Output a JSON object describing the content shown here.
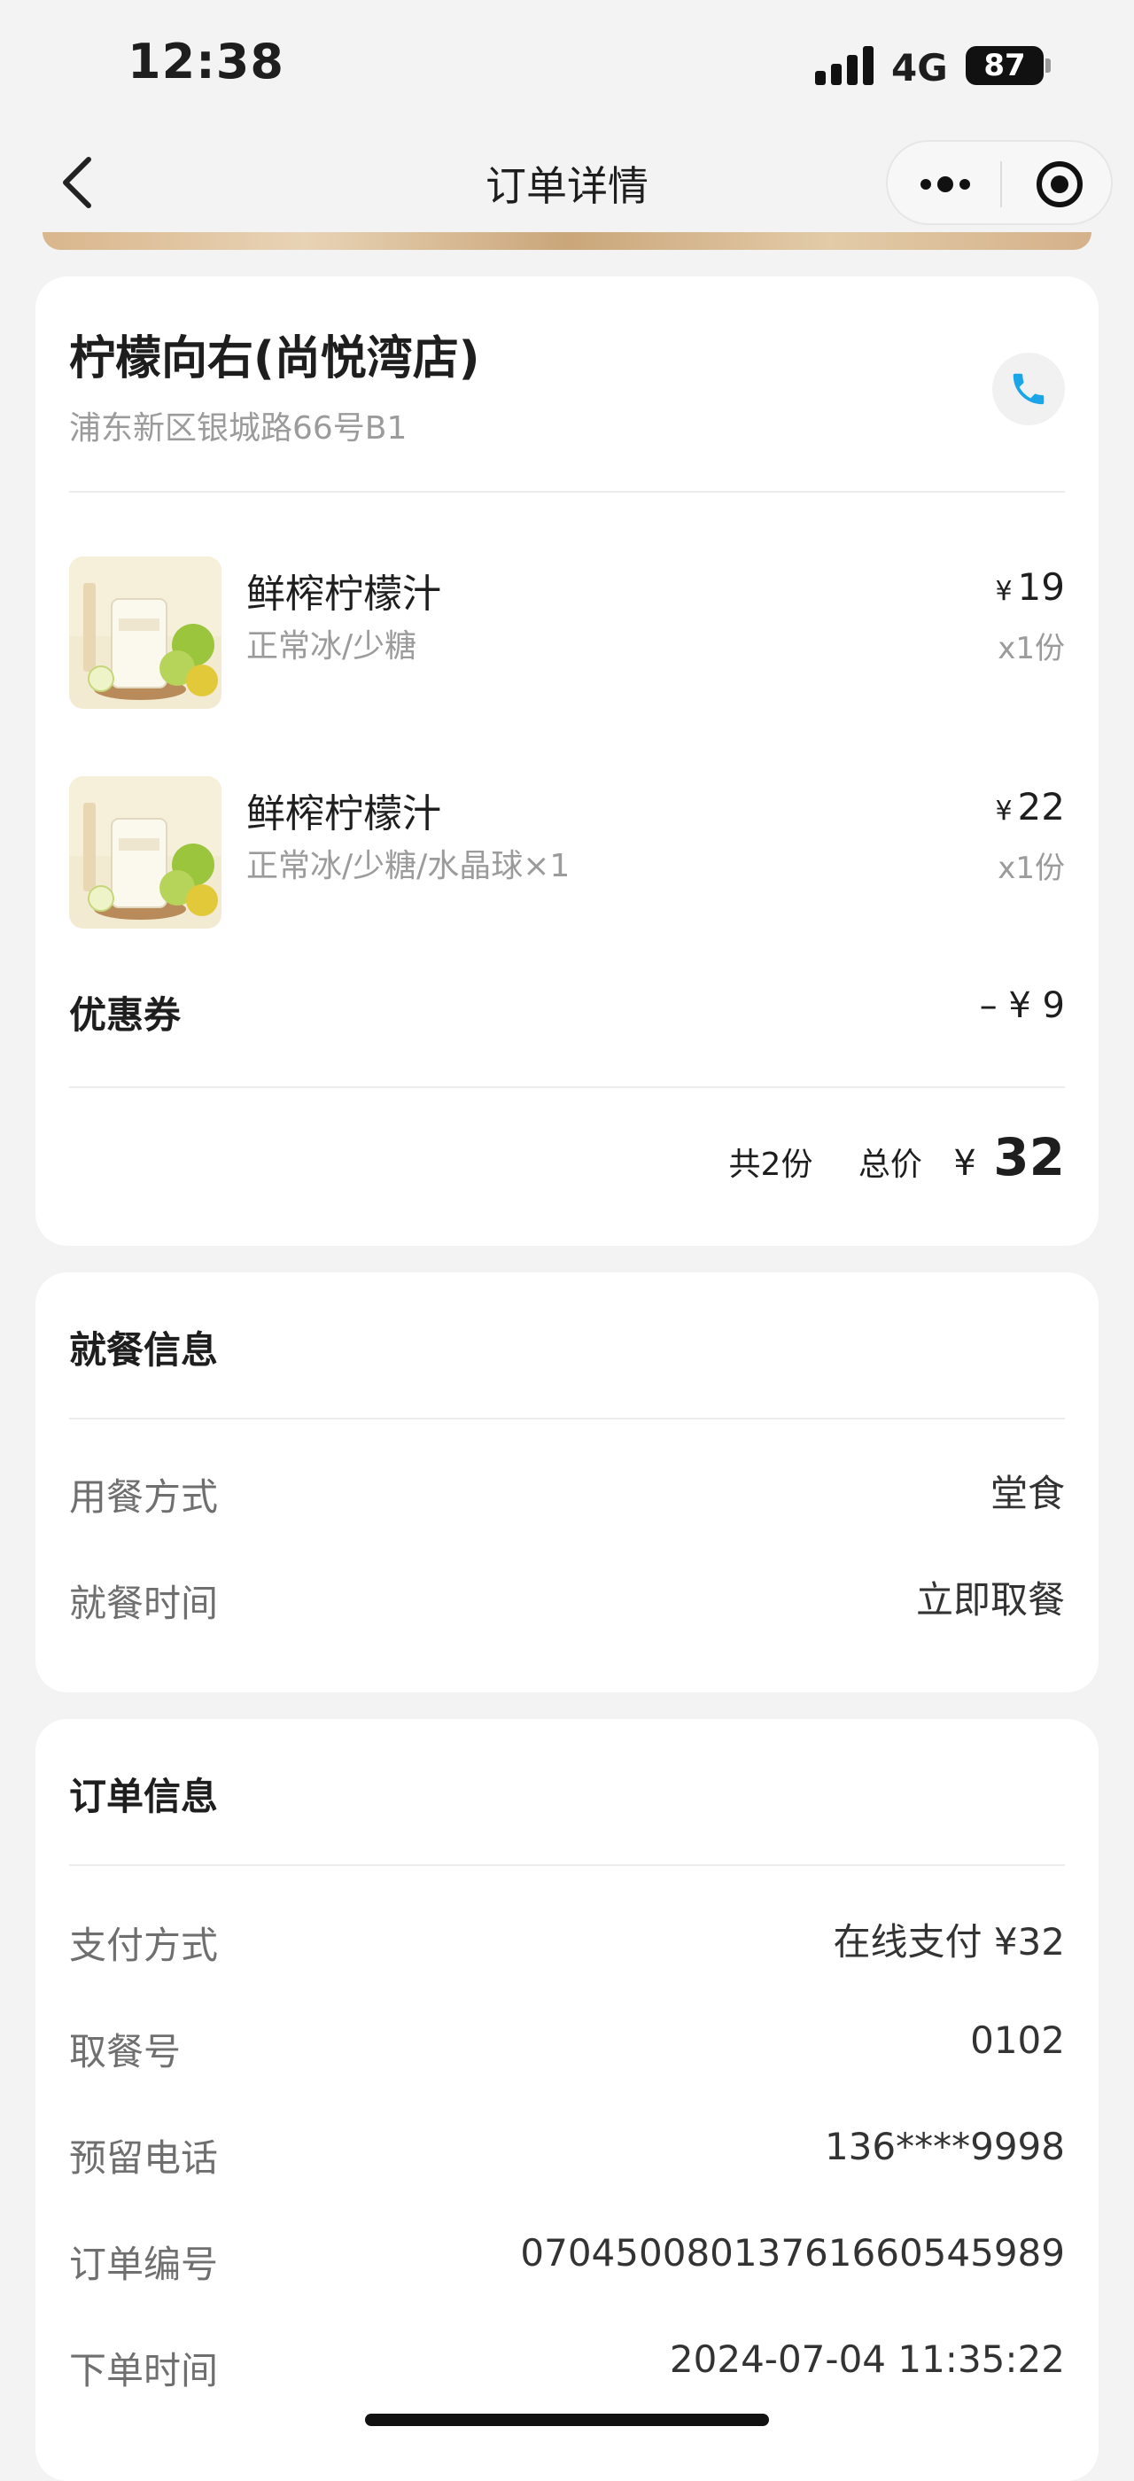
{
  "status_bar": {
    "time": "12:38",
    "network": "4G",
    "battery": "87"
  },
  "nav": {
    "title": "订单详情",
    "back_icon": "chevron-left-icon",
    "more_icon": "more-dots-icon",
    "close_icon": "target-icon"
  },
  "store": {
    "name": "柠檬向右(尚悦湾店)",
    "address": "浦东新区银城路66号B1",
    "phone_icon": "phone-icon",
    "accent_color": "#1aa5e8"
  },
  "items": [
    {
      "name": "鲜榨柠檬汁",
      "spec": "正常冰/少糖",
      "currency": "¥",
      "price": "19",
      "qty": "x1份"
    },
    {
      "name": "鲜榨柠檬汁",
      "spec": "正常冰/少糖/水晶球×1",
      "currency": "¥",
      "price": "22",
      "qty": "x1份"
    }
  ],
  "coupon": {
    "label": "优惠券",
    "value": "– ¥ 9"
  },
  "summary": {
    "count": "共2份",
    "total_label": "总价",
    "currency": "¥",
    "total": "32"
  },
  "dining": {
    "title": "就餐信息",
    "rows": [
      {
        "label": "用餐方式",
        "value": "堂食"
      },
      {
        "label": "就餐时间",
        "value": "立即取餐"
      }
    ]
  },
  "order": {
    "title": "订单信息",
    "rows": [
      {
        "label": "支付方式",
        "value": "在线支付 ¥32"
      },
      {
        "label": "取餐号",
        "value": "0102"
      },
      {
        "label": "预留电话",
        "value": "136****9998"
      },
      {
        "label": "订单编号",
        "value": "0704500801376166054​5989"
      },
      {
        "label": "下单时间",
        "value": "2024-07-04 11:35:22"
      }
    ]
  }
}
